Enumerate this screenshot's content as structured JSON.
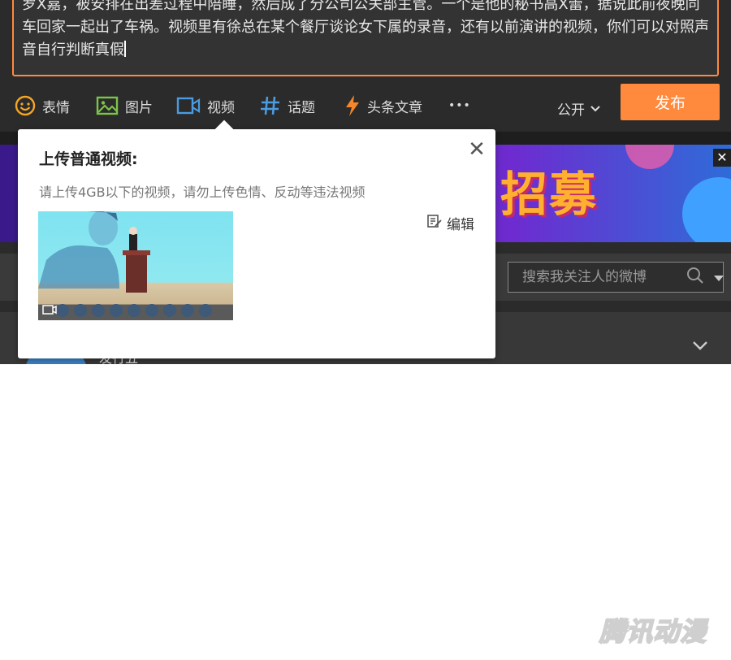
{
  "composer": {
    "text": "罗X嘉，被安排在出差过程中陪睡，然后成了分公司公关部主管。一个是他的秘书高X蕾，据说此前夜晚同车回家一起出了车祸。视频里有徐总在某个餐厅谈论女下属的录音，还有以前演讲的视频，你们可以对照声音自行判断真假"
  },
  "toolbar": {
    "emoji_label": "表情",
    "image_label": "图片",
    "video_label": "视频",
    "topic_label": "话题",
    "article_label": "头条文章",
    "more_label": "•••",
    "privacy_label": "公开",
    "publish_label": "发布"
  },
  "banner": {
    "text": "招募"
  },
  "search": {
    "placeholder": "搜索我关注人的微博"
  },
  "popup": {
    "title": "上传普通视频:",
    "description": "请上传4GB以下的视频，请勿上传色情、反动等违法视频",
    "edit_label": "编辑",
    "close_glyph": "✕"
  },
  "feed": {
    "name": "发行五"
  },
  "watermark": {
    "text": "腾讯动漫"
  },
  "colors": {
    "accent": "#ff8a3d",
    "toolbar_icon_orange": "#f5a623",
    "toolbar_icon_blue": "#4a9be0"
  }
}
